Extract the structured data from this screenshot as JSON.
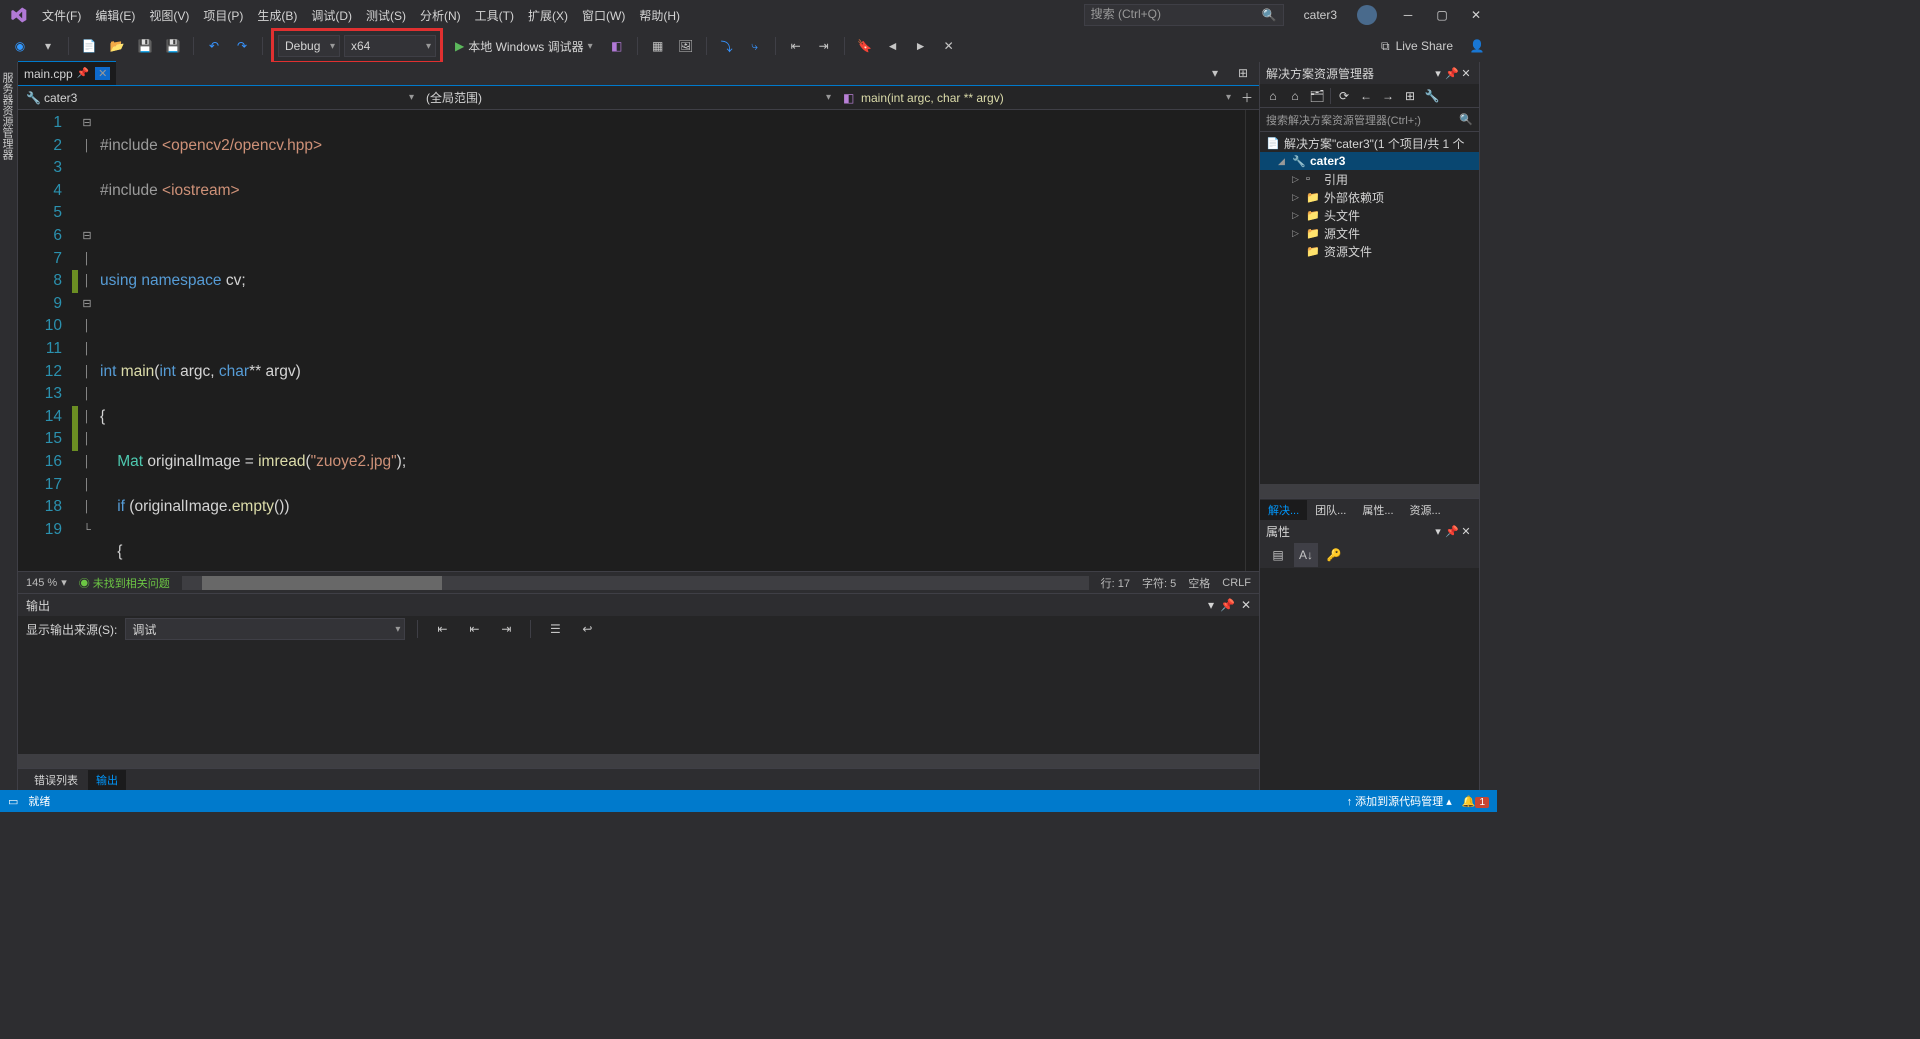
{
  "menu": {
    "file": "文件(F)",
    "edit": "编辑(E)",
    "view": "视图(V)",
    "project": "项目(P)",
    "build": "生成(B)",
    "debug": "调试(D)",
    "test": "测试(S)",
    "analyze": "分析(N)",
    "tools": "工具(T)",
    "extensions": "扩展(X)",
    "window": "窗口(W)",
    "help": "帮助(H)"
  },
  "search_placeholder": "搜索 (Ctrl+Q)",
  "username": "cater3",
  "toolbar": {
    "config": "Debug",
    "platform": "x64",
    "start": "本地 Windows 调试器",
    "liveshare": "Live Share"
  },
  "tab": {
    "filename": "main.cpp"
  },
  "nav": {
    "project": "cater3",
    "scope": "(全局范围)",
    "func": "main(int argc, char ** argv)"
  },
  "code_lines": [
    1,
    2,
    3,
    4,
    5,
    6,
    7,
    8,
    9,
    10,
    11,
    12,
    13,
    14,
    15,
    16,
    17,
    18,
    19
  ],
  "editor_status": {
    "zoom": "145 %",
    "issues": "未找到相关问题",
    "line": "行: 17",
    "col": "字符: 5",
    "ins": "空格",
    "eol": "CRLF"
  },
  "output": {
    "title": "输出",
    "source_label": "显示输出来源(S):",
    "source": "调试"
  },
  "bottom_tabs": {
    "errors": "错误列表",
    "output": "输出"
  },
  "solution": {
    "title": "解决方案资源管理器",
    "search": "搜索解决方案资源管理器(Ctrl+;)",
    "root": "解决方案\"cater3\"(1 个项目/共 1 个",
    "project": "cater3",
    "refs": "引用",
    "ext_deps": "外部依赖项",
    "headers": "头文件",
    "sources": "源文件",
    "resources": "资源文件"
  },
  "panel_tabs": {
    "solution": "解决...",
    "team": "团队...",
    "props": "属性...",
    "resview": "资源..."
  },
  "properties": {
    "title": "属性"
  },
  "statusbar": {
    "ready": "就绪",
    "src_control": "添加到源代码管理",
    "notif": "1"
  }
}
